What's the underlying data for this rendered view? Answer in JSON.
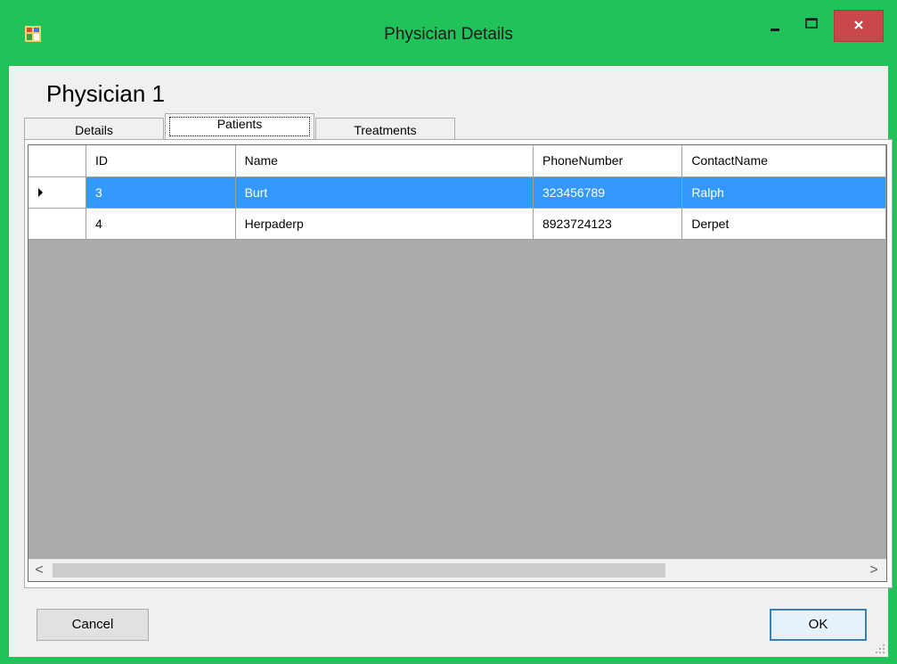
{
  "window": {
    "title": "Physician Details"
  },
  "page": {
    "heading": "Physician 1"
  },
  "tabs": [
    {
      "label": "Details"
    },
    {
      "label": "Patients"
    },
    {
      "label": "Treatments"
    }
  ],
  "grid": {
    "columns": [
      "ID",
      "Name",
      "PhoneNumber",
      "ContactName"
    ],
    "rows": [
      {
        "id": "3",
        "name": "Burt",
        "phone": "323456789",
        "contact": "Ralph",
        "selected": true
      },
      {
        "id": "4",
        "name": "Herpaderp",
        "phone": "8923724123",
        "contact": "Derpet",
        "selected": false
      }
    ],
    "scroll_left_glyph": "<",
    "scroll_right_glyph": ">"
  },
  "buttons": {
    "cancel": "Cancel",
    "ok": "OK"
  },
  "colors": {
    "titlebar": "#22c25a",
    "selection": "#3399ff",
    "close_button": "#c9474a",
    "grid_background": "#ababab"
  },
  "icons": [
    "app-icon",
    "minimize-icon",
    "maximize-icon",
    "close-icon",
    "row-pointer-icon",
    "size-grip-icon"
  ]
}
